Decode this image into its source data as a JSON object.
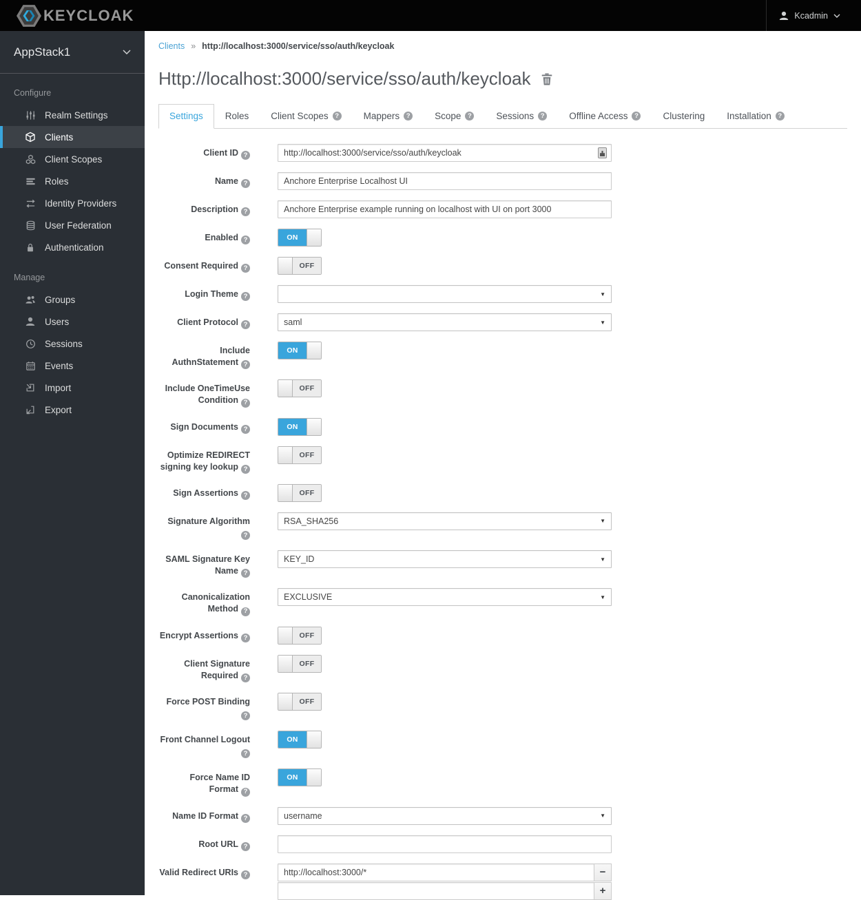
{
  "theme": {
    "accent": "#39a5dc",
    "navbar_bg": "#040404",
    "sidebar_bg": "#2a2f35",
    "active_item_bg": "#3c4147",
    "link_blue": "#4aa2d4"
  },
  "icons": {
    "help": "?",
    "caret": "▼",
    "minus": "−",
    "plus": "+",
    "breadcrumb_separator": "»"
  },
  "navbar": {
    "brand": "KEYCLOAK",
    "user": "Kcadmin"
  },
  "sidebar": {
    "realm": "AppStack1",
    "sections": [
      {
        "title": "Configure",
        "items": [
          {
            "label": "Realm Settings",
            "icon": "sliders-icon"
          },
          {
            "label": "Clients",
            "icon": "cube-icon",
            "active": true
          },
          {
            "label": "Client Scopes",
            "icon": "cubes-icon"
          },
          {
            "label": "Roles",
            "icon": "list-icon"
          },
          {
            "label": "Identity Providers",
            "icon": "exchange-icon"
          },
          {
            "label": "User Federation",
            "icon": "database-icon"
          },
          {
            "label": "Authentication",
            "icon": "lock-icon"
          }
        ]
      },
      {
        "title": "Manage",
        "items": [
          {
            "label": "Groups",
            "icon": "groups-icon"
          },
          {
            "label": "Users",
            "icon": "user-icon"
          },
          {
            "label": "Sessions",
            "icon": "clock-icon"
          },
          {
            "label": "Events",
            "icon": "calendar-icon"
          },
          {
            "label": "Import",
            "icon": "import-icon"
          },
          {
            "label": "Export",
            "icon": "export-icon"
          }
        ]
      }
    ]
  },
  "breadcrumb": {
    "parent": "Clients",
    "current": "http://localhost:3000/service/sso/auth/keycloak"
  },
  "page": {
    "title": "Http://localhost:3000/service/sso/auth/keycloak"
  },
  "tabs": [
    {
      "label": "Settings",
      "active": true,
      "help": false
    },
    {
      "label": "Roles",
      "help": false
    },
    {
      "label": "Client Scopes",
      "help": true
    },
    {
      "label": "Mappers",
      "help": true
    },
    {
      "label": "Scope",
      "help": true
    },
    {
      "label": "Sessions",
      "help": true
    },
    {
      "label": "Offline Access",
      "help": true
    },
    {
      "label": "Clustering",
      "help": false
    },
    {
      "label": "Installation",
      "help": true
    }
  ],
  "form": {
    "client_id": {
      "label": "Client ID",
      "value": "http://localhost:3000/service/sso/auth/keycloak"
    },
    "name": {
      "label": "Name",
      "value": "Anchore Enterprise Localhost UI"
    },
    "description": {
      "label": "Description",
      "value": "Anchore Enterprise example running on localhost with UI on port 3000"
    },
    "enabled": {
      "label": "Enabled",
      "value": "ON"
    },
    "consent_required": {
      "label": "Consent Required",
      "value": "OFF"
    },
    "login_theme": {
      "label": "Login Theme",
      "value": ""
    },
    "client_protocol": {
      "label": "Client Protocol",
      "value": "saml"
    },
    "include_authn_statement": {
      "label": "Include AuthnStatement",
      "value": "ON"
    },
    "include_onetimeuse_condition": {
      "label": "Include OneTimeUse Condition",
      "value": "OFF"
    },
    "sign_documents": {
      "label": "Sign Documents",
      "value": "ON"
    },
    "optimize_redirect": {
      "label": "Optimize REDIRECT signing key lookup",
      "value": "OFF"
    },
    "sign_assertions": {
      "label": "Sign Assertions",
      "value": "OFF"
    },
    "signature_algorithm": {
      "label": "Signature Algorithm",
      "value": "RSA_SHA256"
    },
    "saml_signature_key_name": {
      "label": "SAML Signature Key Name",
      "value": "KEY_ID"
    },
    "canonicalization_method": {
      "label": "Canonicalization Method",
      "value": "EXCLUSIVE"
    },
    "encrypt_assertions": {
      "label": "Encrypt Assertions",
      "value": "OFF"
    },
    "client_signature_required": {
      "label": "Client Signature Required",
      "value": "OFF"
    },
    "force_post_binding": {
      "label": "Force POST Binding",
      "value": "OFF"
    },
    "front_channel_logout": {
      "label": "Front Channel Logout",
      "value": "ON"
    },
    "force_name_id_format": {
      "label": "Force Name ID Format",
      "value": "ON"
    },
    "name_id_format": {
      "label": "Name ID Format",
      "value": "username"
    },
    "root_url": {
      "label": "Root URL",
      "value": ""
    },
    "valid_redirect_uris": {
      "label": "Valid Redirect URIs",
      "values": [
        "http://localhost:3000/*",
        ""
      ]
    }
  }
}
